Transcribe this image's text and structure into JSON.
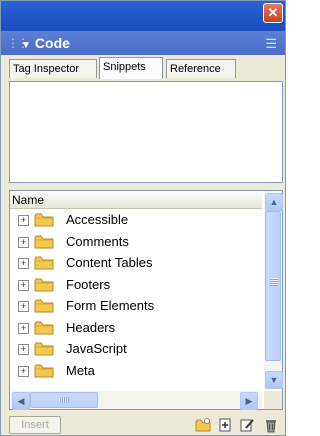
{
  "titlebar": {
    "close_icon": "close-icon",
    "close_glyph": "✕"
  },
  "panel": {
    "title": "Code",
    "collapse_icon": "triangle-down-icon",
    "options_icon": "panel-options-icon"
  },
  "tabs": [
    {
      "label": "Tag Inspector",
      "active": false
    },
    {
      "label": "Snippets",
      "active": true
    },
    {
      "label": "Reference",
      "active": false
    }
  ],
  "tree": {
    "column_header": "Name",
    "items": [
      {
        "label": "Accessible"
      },
      {
        "label": "Comments"
      },
      {
        "label": "Content Tables"
      },
      {
        "label": "Footers"
      },
      {
        "label": "Form Elements"
      },
      {
        "label": "Headers"
      },
      {
        "label": "JavaScript"
      },
      {
        "label": "Meta"
      }
    ]
  },
  "footer": {
    "insert_label": "Insert",
    "icons": [
      "new-folder-icon",
      "new-snippet-icon",
      "edit-snippet-icon",
      "delete-icon"
    ]
  },
  "colors": {
    "titlebar": "#1f56c8",
    "panelhead": "#4a6ec6",
    "folder": "#f2c94c"
  }
}
